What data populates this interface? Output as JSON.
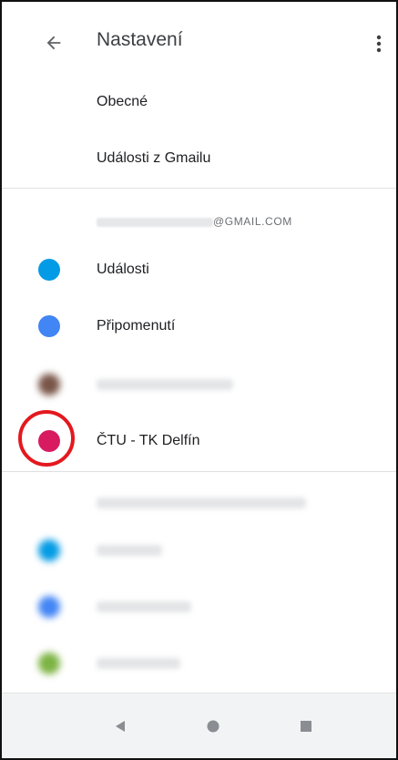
{
  "appbar": {
    "title": "Nastavení",
    "back_icon": "arrow-left-icon",
    "more_icon": "more-vert-icon"
  },
  "general": {
    "items": [
      {
        "label": "Obecné"
      },
      {
        "label": "Události z Gmailu"
      }
    ]
  },
  "account1": {
    "email_suffix": "@GMAIL.COM",
    "calendars": [
      {
        "label": "Události",
        "color": "#039be5"
      },
      {
        "label": "Připomenutí",
        "color": "#4285f4"
      },
      {
        "label": "",
        "color": "#795548"
      },
      {
        "label": "ČTU - TK Delfín",
        "color": "#d81b60"
      }
    ]
  },
  "account2": {
    "calendars": [
      {
        "color": "#039be5"
      },
      {
        "color": "#4285f4"
      },
      {
        "color": "#7cb342"
      }
    ]
  },
  "highlight_color": "#e3191f",
  "navbar": {
    "icons": [
      "nav-back-icon",
      "nav-home-icon",
      "nav-recents-icon"
    ]
  }
}
